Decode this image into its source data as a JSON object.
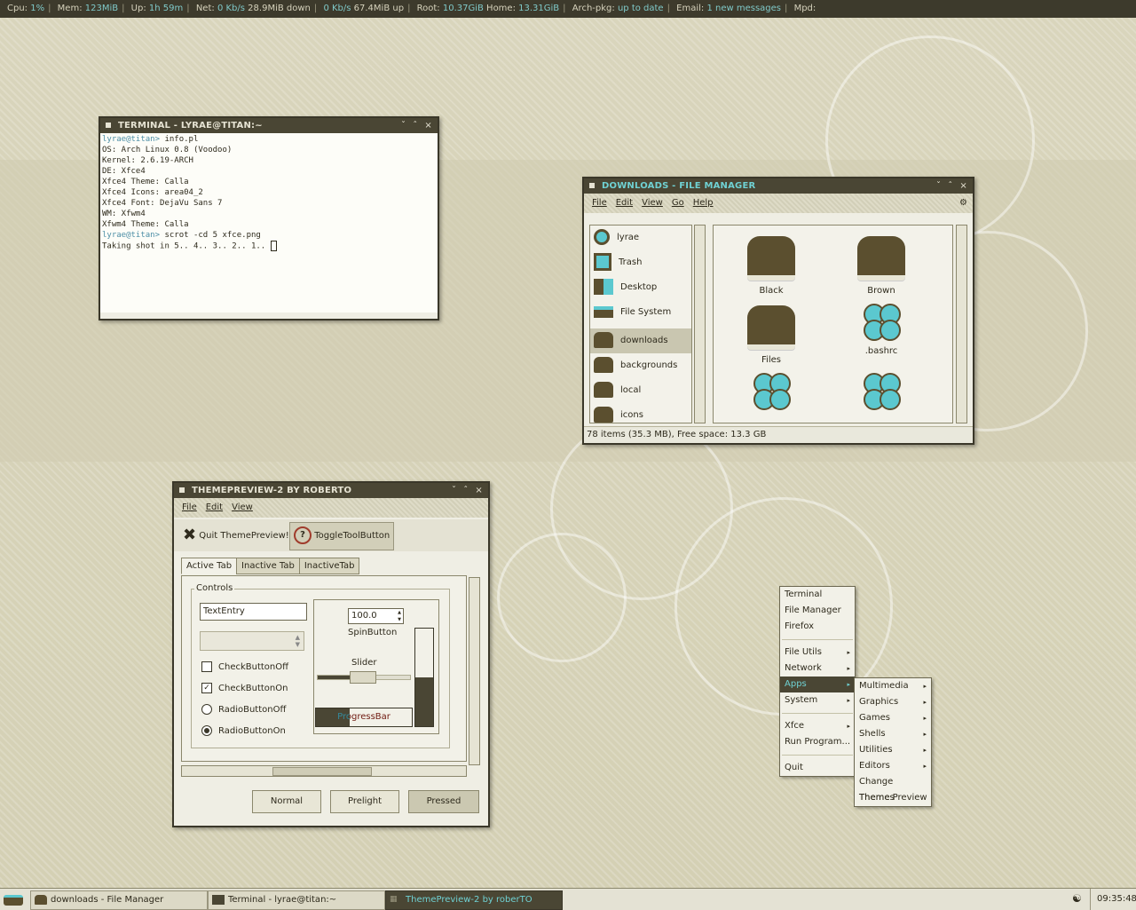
{
  "panel": {
    "cpu_label": "Cpu:",
    "cpu": "1%",
    "mem_label": "Mem:",
    "mem": "123MiB",
    "up_label": "Up:",
    "up": "1h 59m",
    "net_label": "Net:",
    "net_in_rate": "0 Kb/s",
    "net_in_total": "28.9MiB down",
    "net_out_rate": "0 Kb/s",
    "net_out_total": "67.4MiB up",
    "root_label": "Root:",
    "root": "10.37GiB",
    "home_label": "Home:",
    "home": "13.31GiB",
    "archpkg_label": "Arch-pkg:",
    "archpkg": "up to date",
    "email_label": "Email:",
    "email": "1 new messages",
    "mpd_label": "Mpd:"
  },
  "terminal": {
    "title": "TERMINAL - LYRAE@TITAN:~",
    "lines": [
      {
        "prompt": "lyrae@titan>",
        "text": " info.pl"
      },
      {
        "prompt": "",
        "text": "OS: Arch Linux 0.8 (Voodoo)"
      },
      {
        "prompt": "",
        "text": "Kernel: 2.6.19-ARCH"
      },
      {
        "prompt": "",
        "text": "DE: Xfce4"
      },
      {
        "prompt": "",
        "text": "Xfce4 Theme: Calla"
      },
      {
        "prompt": "",
        "text": "Xfce4 Icons: area04_2"
      },
      {
        "prompt": "",
        "text": "Xfce4 Font: DejaVu Sans 7"
      },
      {
        "prompt": "",
        "text": "WM: Xfwm4"
      },
      {
        "prompt": "",
        "text": "Xfwm4 Theme: Calla"
      },
      {
        "prompt": "lyrae@titan>",
        "text": " scrot -cd 5 xfce.png"
      },
      {
        "prompt": "",
        "text": "Taking shot in 5.. 4.. 3.. 2.. 1.. "
      }
    ]
  },
  "filemanager": {
    "title": "DOWNLOADS - FILE MANAGER",
    "menu": [
      "File",
      "Edit",
      "View",
      "Go",
      "Help"
    ],
    "places": [
      "lyrae",
      "Trash",
      "Desktop",
      "File System",
      "downloads",
      "backgrounds",
      "local",
      "icons"
    ],
    "items": [
      "Black",
      "Brown",
      "Files",
      ".bashrc"
    ],
    "status": "78 items (35.3 MB), Free space: 13.3 GB"
  },
  "preview": {
    "title": "THEMEPREVIEW-2 BY ROBERTO",
    "menu": [
      "File",
      "Edit",
      "View"
    ],
    "quit_label": "Quit ThemePreview!",
    "toggle_label": "ToggleToolButton",
    "tabs": [
      "Active Tab",
      "Inactive Tab",
      "InactiveTab"
    ],
    "controls_label": "Controls",
    "textentry": "TextEntry",
    "check_off": "CheckButtonOff",
    "check_on": "CheckButtonOn",
    "radio_off": "RadioButtonOff",
    "radio_on": "RadioButtonOn",
    "spin_value": "100.0",
    "spin_label": "SpinButton",
    "slider_label": "Slider",
    "progress_label": "ProgressBar",
    "progress_fraction": 0.35,
    "vertical_level": 0.5,
    "btn_normal": "Normal",
    "btn_prelight": "Prelight",
    "btn_pressed": "Pressed"
  },
  "menu": {
    "items": [
      {
        "label": "Terminal",
        "sub": false
      },
      {
        "label": "File Manager",
        "sub": false
      },
      {
        "label": "Firefox",
        "sub": false
      },
      {
        "label": "File Utils",
        "sub": true
      },
      {
        "label": "Network",
        "sub": true
      },
      {
        "label": "Apps",
        "sub": true
      },
      {
        "label": "System",
        "sub": true
      },
      {
        "label": "Xfce",
        "sub": true
      },
      {
        "label": "Run Program...",
        "sub": false
      },
      {
        "label": "Quit",
        "sub": false
      }
    ],
    "submenu": [
      {
        "label": "Multimedia",
        "sub": true
      },
      {
        "label": "Graphics",
        "sub": true
      },
      {
        "label": "Games",
        "sub": true
      },
      {
        "label": "Shells",
        "sub": true
      },
      {
        "label": "Utilities",
        "sub": true
      },
      {
        "label": "Editors",
        "sub": true
      },
      {
        "label": "Change Themes",
        "sub": false
      },
      {
        "label": "Theme Preview",
        "sub": false
      }
    ]
  },
  "taskbar": {
    "tasks": [
      "downloads - File Manager",
      "Terminal - lyrae@titan:~",
      "ThemePreview-2 by roberTO"
    ],
    "clock": "09:35:48"
  },
  "colors": {
    "accent": "#6fd1d3",
    "dark": "#4a4634",
    "folder": "#5b4f2f"
  }
}
